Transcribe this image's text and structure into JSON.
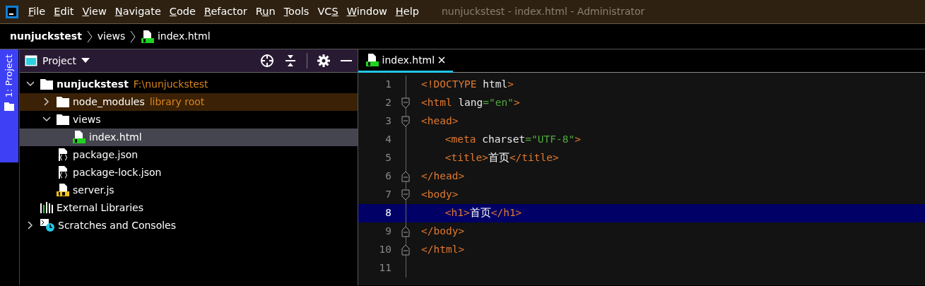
{
  "window": {
    "title": "nunjuckstest - index.html - Administrator"
  },
  "menu": [
    {
      "key": "F",
      "after": "ile"
    },
    {
      "key": "E",
      "after": "dit"
    },
    {
      "key": "V",
      "after": "iew"
    },
    {
      "key": "N",
      "after": "avigate"
    },
    {
      "key": "C",
      "after": "ode"
    },
    {
      "key": "R",
      "after": "efactor"
    },
    {
      "before": "R",
      "key": "u",
      "after": "n"
    },
    {
      "key": "T",
      "after": "ools"
    },
    {
      "before": "VC",
      "key": "S"
    },
    {
      "key": "W",
      "after": "indow"
    },
    {
      "key": "H",
      "after": "elp"
    }
  ],
  "breadcrumb": [
    {
      "label": "nunjuckstest",
      "kind": "project"
    },
    {
      "label": "views",
      "kind": "folder"
    },
    {
      "label": "index.html",
      "kind": "html"
    }
  ],
  "side_tab": {
    "label": "1: Project",
    "selected": true
  },
  "project_panel": {
    "title": "Project",
    "tree": [
      {
        "name": "nunjuckstest",
        "hint": "F:\\nunjuckstest",
        "kind": "root",
        "expanded": true,
        "selected": false,
        "library": false,
        "children": [
          {
            "name": "node_modules",
            "hint": "library root",
            "kind": "folder",
            "expanded": false,
            "selected": false,
            "library": true
          },
          {
            "name": "views",
            "kind": "folder",
            "expanded": true,
            "selected": false,
            "library": false,
            "children": [
              {
                "name": "index.html",
                "kind": "html",
                "selected": true,
                "library": false
              }
            ]
          },
          {
            "name": "package.json",
            "kind": "json",
            "selected": false,
            "library": false
          },
          {
            "name": "package-lock.json",
            "kind": "json",
            "selected": false,
            "library": false
          },
          {
            "name": "server.js",
            "kind": "js",
            "selected": false,
            "library": false
          }
        ]
      },
      {
        "name": "External Libraries",
        "kind": "libraries",
        "selected": false,
        "library": false
      },
      {
        "name": "Scratches and Consoles",
        "kind": "scratches",
        "expanded": false,
        "selected": false,
        "library": false
      }
    ]
  },
  "editor": {
    "tabs": [
      {
        "label": "index.html",
        "kind": "html",
        "selected": true
      }
    ],
    "lines": [
      {
        "number": "1",
        "kind": "plain",
        "current": false,
        "tokens": [
          {
            "kind": "tag",
            "text": "<!DOCTYPE "
          },
          {
            "kind": "attr",
            "text": "html"
          },
          {
            "kind": "tag",
            "text": ">"
          }
        ]
      },
      {
        "number": "2",
        "kind": "opener",
        "current": false,
        "tokens": [
          {
            "kind": "tag",
            "text": "<html "
          },
          {
            "kind": "attr",
            "text": "lang"
          },
          {
            "kind": "string",
            "text": "=\"en\""
          },
          {
            "kind": "tag",
            "text": ">"
          }
        ]
      },
      {
        "number": "3",
        "kind": "opener",
        "current": false,
        "tokens": [
          {
            "kind": "tag",
            "text": "<head>"
          }
        ]
      },
      {
        "number": "4",
        "kind": "plain",
        "current": false,
        "indent": true,
        "tokens": [
          {
            "kind": "tag",
            "text": "<meta "
          },
          {
            "kind": "attr",
            "text": "charset"
          },
          {
            "kind": "string",
            "text": "=\"UTF-8\""
          },
          {
            "kind": "tag",
            "text": ">"
          }
        ]
      },
      {
        "number": "5",
        "kind": "plain",
        "current": false,
        "indent": true,
        "tokens": [
          {
            "kind": "tag",
            "text": "<title>"
          },
          {
            "kind": "text",
            "text": "首页"
          },
          {
            "kind": "tag",
            "text": "</title>"
          }
        ]
      },
      {
        "number": "6",
        "kind": "closer",
        "current": false,
        "tokens": [
          {
            "kind": "tag",
            "text": "</head>"
          }
        ]
      },
      {
        "number": "7",
        "kind": "opener",
        "current": false,
        "tokens": [
          {
            "kind": "tag",
            "text": "<body>"
          }
        ]
      },
      {
        "number": "8",
        "kind": "plain",
        "current": true,
        "indent": true,
        "tokens": [
          {
            "kind": "tag",
            "text": "<h1>"
          },
          {
            "kind": "text",
            "text": "首页"
          },
          {
            "kind": "tag",
            "text": "</h1>"
          }
        ]
      },
      {
        "number": "9",
        "kind": "closer",
        "current": false,
        "tokens": [
          {
            "kind": "tag",
            "text": "</body>"
          }
        ]
      },
      {
        "number": "10",
        "kind": "closer",
        "current": false,
        "tokens": [
          {
            "kind": "tag",
            "text": "</html>"
          }
        ]
      },
      {
        "number": "11",
        "kind": "plain",
        "current": false
      }
    ]
  }
}
